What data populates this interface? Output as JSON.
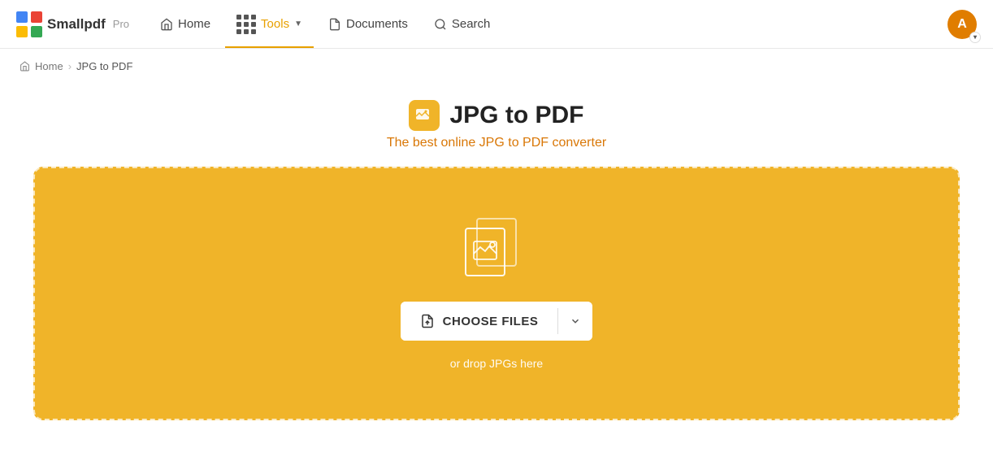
{
  "logo": {
    "text": "Smallpdf",
    "pro_label": "Pro"
  },
  "nav": {
    "home_label": "Home",
    "tools_label": "Tools",
    "documents_label": "Documents",
    "search_label": "Search",
    "avatar_initial": "A"
  },
  "breadcrumb": {
    "home": "Home",
    "current": "JPG to PDF"
  },
  "page": {
    "title": "JPG to PDF",
    "subtitle": "The best online JPG to PDF converter",
    "choose_files_label": "CHOOSE FILES",
    "drop_hint": "or drop JPGs here"
  }
}
